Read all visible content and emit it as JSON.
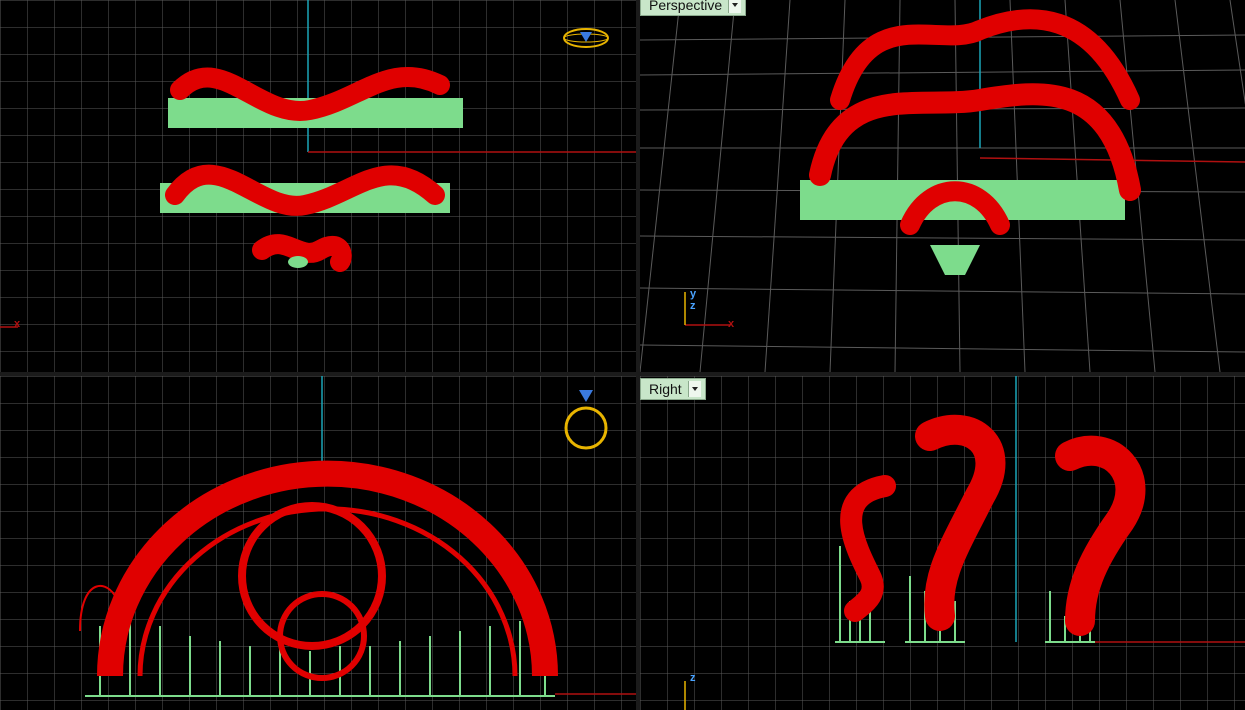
{
  "viewports": {
    "top": {
      "label": ""
    },
    "perspective": {
      "label": "Perspective"
    },
    "front": {
      "label": ""
    },
    "right": {
      "label": "Right"
    }
  },
  "axis_labels": {
    "x": "x",
    "y": "y",
    "z": "z"
  },
  "colors": {
    "background": "#000000",
    "grid": "#3c3c3c",
    "grid_major": "#6a6a6a",
    "model": "#e00000",
    "supports": "#7ddc8c",
    "x_axis": "#b01010",
    "y_axis": "#1aa6b8",
    "gizmo": "#e8b400"
  },
  "icons": [
    "ring-gizmo-icon",
    "viewport-dropdown-icon",
    "axis-triad-icon"
  ]
}
